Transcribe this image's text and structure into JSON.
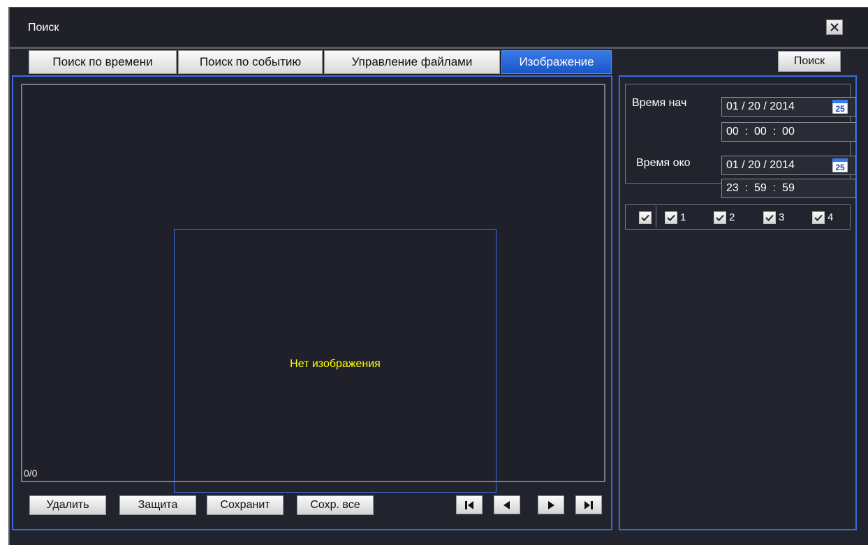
{
  "window": {
    "title": "Поиск",
    "close_icon": "close-icon"
  },
  "tabs": [
    {
      "label": "Поиск по времени",
      "active": false
    },
    {
      "label": "Поиск по событию",
      "active": false
    },
    {
      "label": "Управление файлами",
      "active": false
    },
    {
      "label": "Изображение",
      "active": true
    }
  ],
  "search_button": "Поиск",
  "viewer": {
    "empty_message": "Нет изображения",
    "counter": "0/0"
  },
  "actions": {
    "delete": "Удалить",
    "protect": "Защита",
    "save": "Сохранит",
    "save_all": "Сохр. все"
  },
  "navigation": [
    "first-icon",
    "prev-icon",
    "next-icon",
    "last-icon"
  ],
  "time_filter": {
    "start_label": "Время нач",
    "start_date": "01 / 20 / 2014",
    "start_time": "00  :  00  :  00",
    "end_label": "Время око",
    "end_date": "01 / 20 / 2014",
    "end_time": "23  :  59  :  59",
    "calendar_icon_day": "25"
  },
  "channels": {
    "all_checked": true,
    "items": [
      {
        "label": "1",
        "checked": true
      },
      {
        "label": "2",
        "checked": true
      },
      {
        "label": "3",
        "checked": true
      },
      {
        "label": "4",
        "checked": true
      }
    ]
  },
  "colors": {
    "accent": "#3c6be0",
    "active_tab": "#1f5fd6",
    "message": "#ffff00",
    "background": "#22242d"
  }
}
